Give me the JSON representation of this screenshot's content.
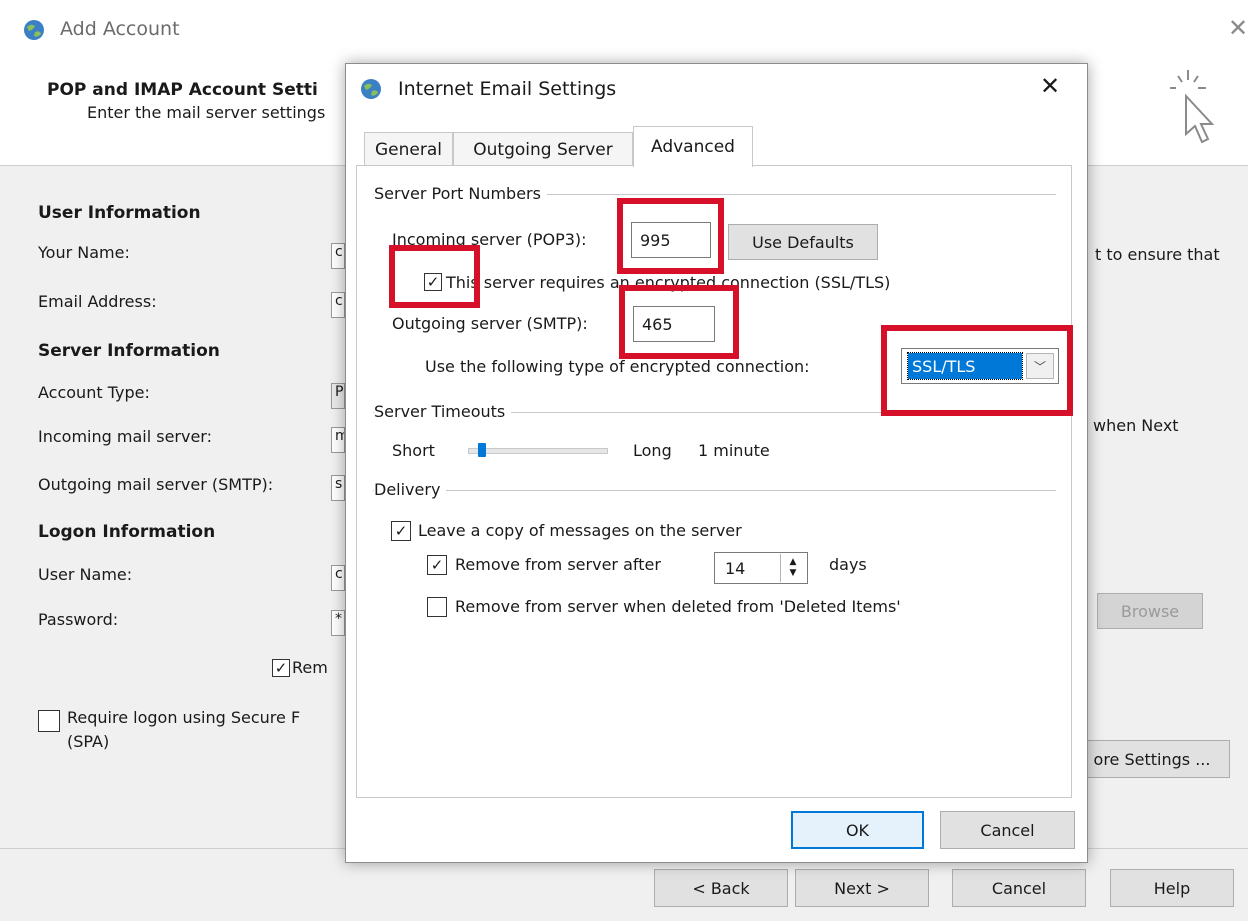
{
  "background": {
    "window_title": "Add Account",
    "heading": "POP and IMAP Account Setti",
    "subheading": "Enter the mail server settings",
    "user_info": {
      "section": "User Information",
      "your_name": "Your Name:",
      "email_address": "Email Address:",
      "stub_name": "c",
      "stub_email": "c"
    },
    "server_info": {
      "section": "Server Information",
      "account_type": "Account Type:",
      "incoming": "Incoming mail server:",
      "outgoing": "Outgoing mail server (SMTP):",
      "stub_type": "P",
      "stub_in": "m",
      "stub_out": "s"
    },
    "logon_info": {
      "section": "Logon Information",
      "user_name": "User Name:",
      "password": "Password:",
      "stub_user": "c",
      "stub_pass": "*",
      "remember": "Rem",
      "spa": "Require logon using Secure F",
      "spa_suffix": "(SPA)"
    },
    "right_text_1": "t to ensure that",
    "right_text_2": "when Next",
    "browse_label": "Browse",
    "more_settings_label": "ore Settings ...",
    "nav": {
      "back": "< Back",
      "next": "Next >",
      "cancel": "Cancel",
      "help": "Help"
    }
  },
  "dialog": {
    "title": "Internet Email Settings",
    "tabs": [
      {
        "label": "General"
      },
      {
        "label": "Outgoing Server"
      },
      {
        "label": "Advanced"
      }
    ],
    "ports": {
      "group": "Server Port Numbers",
      "incoming_label": "Incoming server (POP3):",
      "incoming_value": "995",
      "use_defaults": "Use Defaults",
      "encrypted_label": "This server requires an encrypted connection (SSL/TLS)",
      "outgoing_label": "Outgoing server (SMTP):",
      "outgoing_value": "465",
      "encryption_type_label": "Use the following type of encrypted connection:",
      "encryption_type_value": "SSL/TLS"
    },
    "timeouts": {
      "group": "Server Timeouts",
      "short": "Short",
      "long": "Long",
      "value": "1 minute",
      "slider_level": 0.1
    },
    "delivery": {
      "group": "Delivery",
      "leave_copy": "Leave a copy of messages on the server",
      "remove_after": "Remove from server after",
      "days_value": "14",
      "days_label": "days",
      "remove_deleted": "Remove from server when deleted from 'Deleted Items'"
    },
    "ok": "OK",
    "cancel": "Cancel"
  },
  "colors": {
    "highlight": "#d7102a",
    "accent": "#0078d7"
  }
}
